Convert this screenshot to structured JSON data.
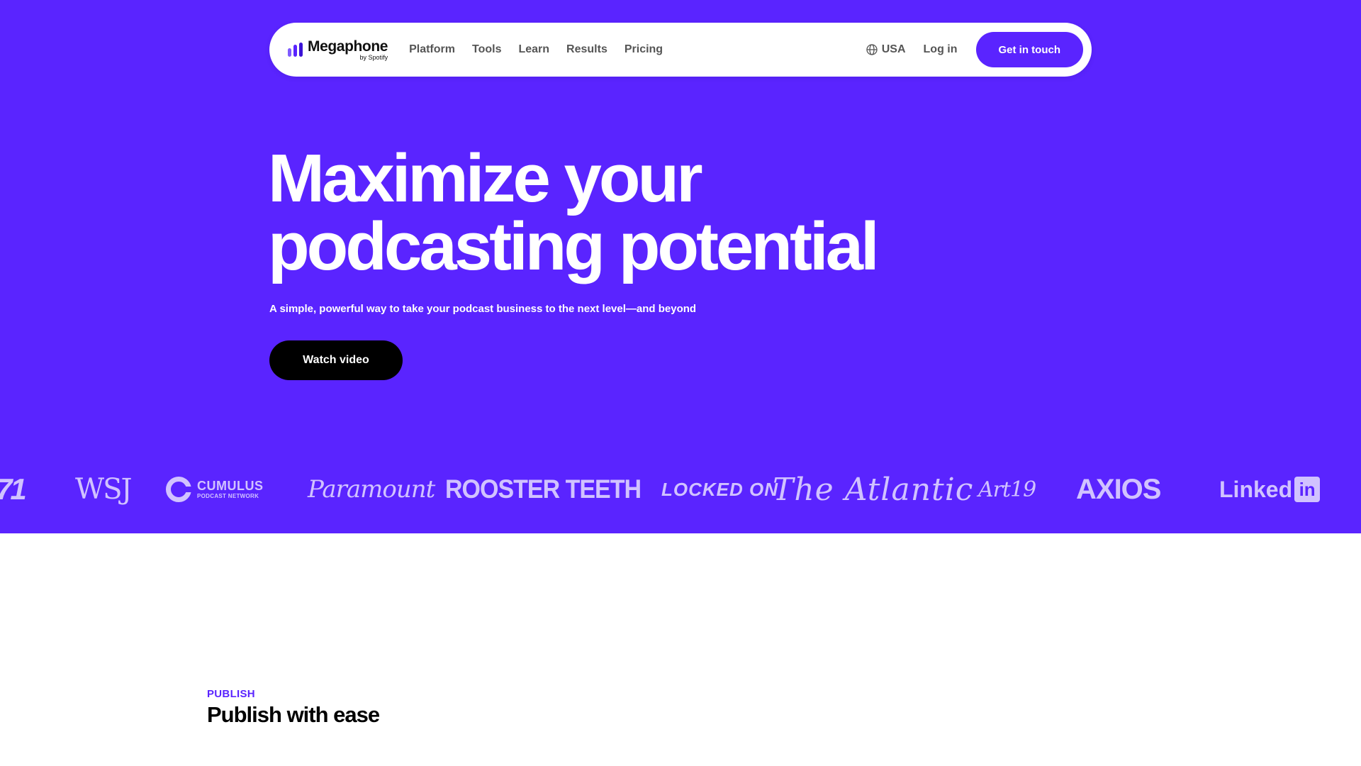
{
  "brand": {
    "name": "Megaphone",
    "sub": "by Spotify",
    "accent": "#5a24ff",
    "logo_bars": [
      "#7e5bff",
      "#5a24ff",
      "#3b13d6"
    ]
  },
  "nav": {
    "items": [
      {
        "label": "Platform"
      },
      {
        "label": "Tools"
      },
      {
        "label": "Learn"
      },
      {
        "label": "Results"
      },
      {
        "label": "Pricing"
      }
    ],
    "region": {
      "icon": "globe-icon",
      "label": "USA"
    },
    "login_label": "Log in",
    "cta_label": "Get in touch"
  },
  "hero": {
    "headline_line1": "Maximize your",
    "headline_line2": "podcasting potential",
    "subhead": "A simple, powerful way to take your podcast business to the next level—and beyond",
    "button_label": "Watch video",
    "background": "#5a24ff"
  },
  "partners": {
    "partial_logo": "71",
    "wsj": "WSJ",
    "cumulus": "CUMULUS",
    "cumulus_sub": "PODCAST NETWORK",
    "paramount": "Paramount",
    "rooster_teeth": "ROOSTER TEETH",
    "locked_on": "LOCKED ON",
    "atlantic": "The Atlantic",
    "art19": "Art19",
    "axios": "AXIOS",
    "linkedin": "Linked",
    "linkedin_in": "in"
  },
  "publish": {
    "eyebrow": "PUBLISH",
    "title": "Publish with ease"
  }
}
